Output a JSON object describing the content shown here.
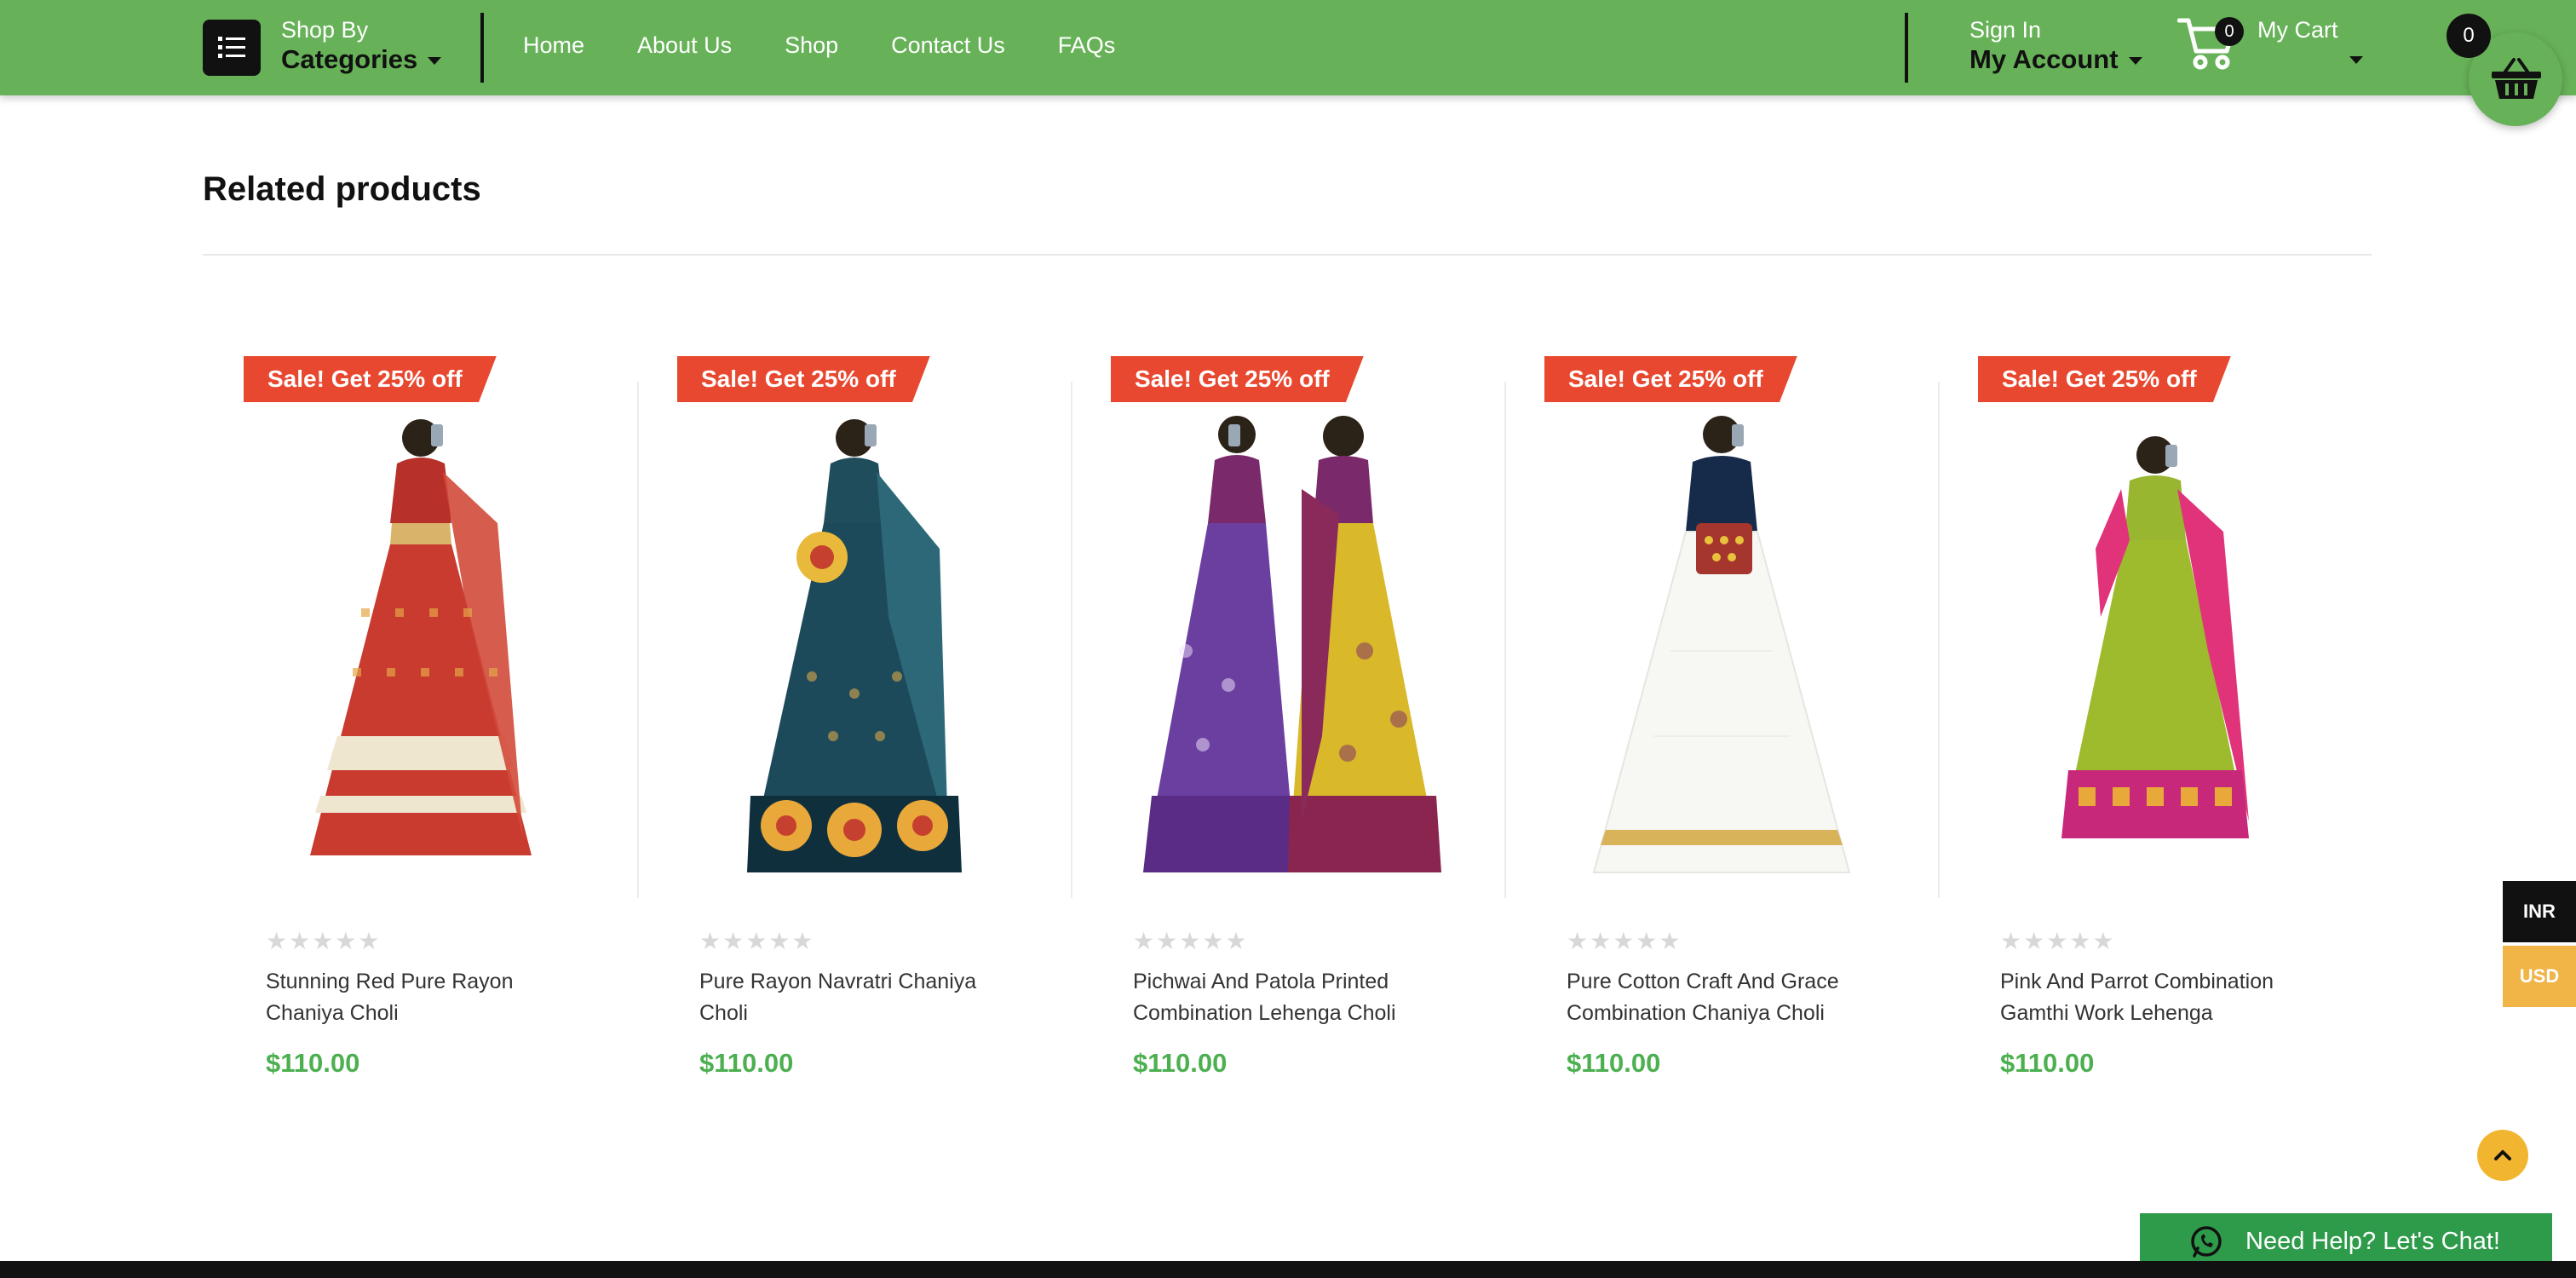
{
  "header": {
    "categories_small": "Shop By",
    "categories_big": "Categories",
    "nav": [
      "Home",
      "About Us",
      "Shop",
      "Contact Us",
      "FAQs"
    ],
    "signin_small": "Sign In",
    "signin_big": "My Account",
    "cart_label": "My Cart",
    "cart_count": "0",
    "basket_count": "0",
    "accent_color": "#67b258"
  },
  "section": {
    "title": "Related products"
  },
  "products": [
    {
      "badge": "Sale! Get 25% off",
      "name": "Stunning Red Pure Rayon Chaniya Choli",
      "price": "$110.00",
      "rating": 0
    },
    {
      "badge": "Sale! Get 25% off",
      "name": "Pure Rayon Navratri Chaniya Choli",
      "price": "$110.00",
      "rating": 0
    },
    {
      "badge": "Sale! Get 25% off",
      "name": "Pichwai And Patola Printed Combination Lehenga Choli",
      "price": "$110.00",
      "rating": 0
    },
    {
      "badge": "Sale! Get 25% off",
      "name": "Pure Cotton Craft And Grace Combination Chaniya Choli",
      "price": "$110.00",
      "rating": 0
    },
    {
      "badge": "Sale! Get 25% off",
      "name": "Pink And Parrot Combination Gamthi Work Lehenga",
      "price": "$110.00",
      "rating": 0
    }
  ],
  "currency": {
    "primary": "INR",
    "secondary": "USD"
  },
  "chat": {
    "label": "Need Help? Let's Chat!"
  }
}
